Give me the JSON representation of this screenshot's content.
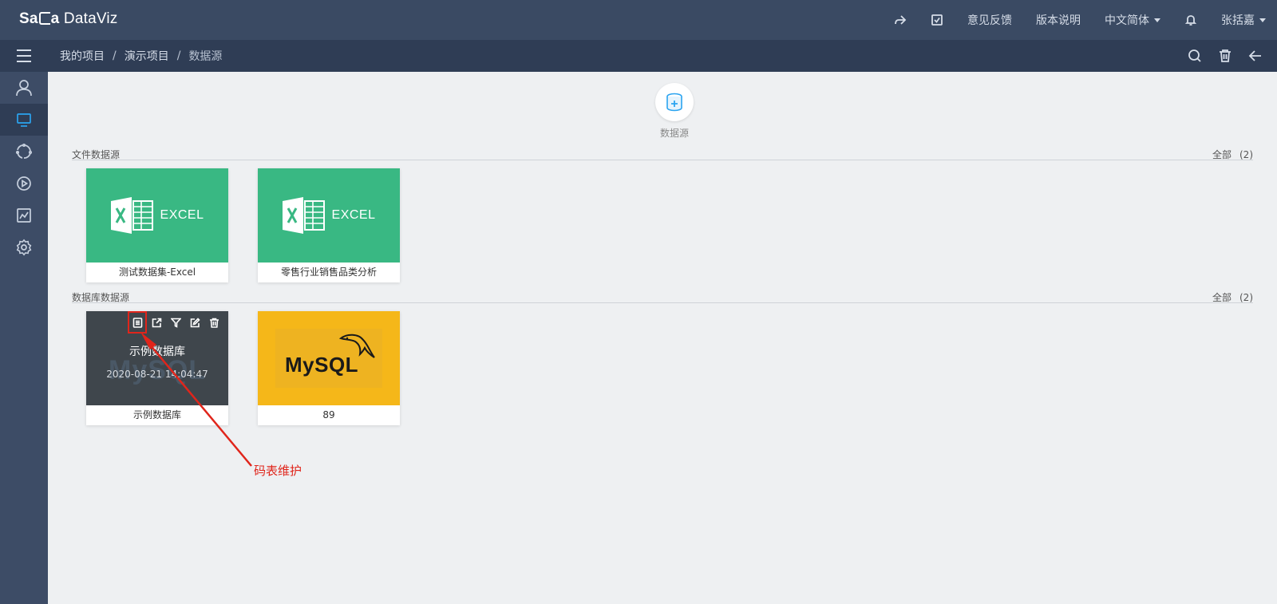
{
  "app": {
    "logo_left": "Sa",
    "logo_mid": "C",
    "logo_a": "a",
    "logo_right": " DataViz"
  },
  "header": {
    "share_icon": "share-icon",
    "task_icon": "checkbox-icon",
    "feedback": "意见反馈",
    "release_notes": "版本说明",
    "language": "中文简体",
    "bell_icon": "bell-icon",
    "user": "张括嘉"
  },
  "breadcrumb": {
    "items": [
      "我的项目",
      "演示项目",
      "数据源"
    ],
    "separator": "/"
  },
  "toolbar": {
    "icons": [
      "search-icon",
      "trash-icon",
      "back-arrow-icon"
    ]
  },
  "sidebar": {
    "items": [
      "user-icon",
      "monitor-icon",
      "cycle-icon",
      "play-icon",
      "chart-icon",
      "settings-icon"
    ],
    "active_index": 1
  },
  "add_datasource": {
    "label": "数据源"
  },
  "file_section": {
    "title": "文件数据源",
    "all_label": "全部",
    "count": "(2)",
    "cards": [
      {
        "type": "excel",
        "logo_text": "EXCEL",
        "name": "测试数据集-Excel"
      },
      {
        "type": "excel",
        "logo_text": "EXCEL",
        "name": "零售行业销售品类分析"
      }
    ]
  },
  "db_section": {
    "title": "数据库数据源",
    "all_label": "全部",
    "count": "(2)",
    "cards": [
      {
        "type": "mysql-hover",
        "overlay_title": "示例数据库",
        "overlay_date": "2020-08-21 14:04:47",
        "watermark": "MySQL",
        "name": "示例数据库",
        "actions": [
          "code-table-icon",
          "export-icon",
          "filter-icon",
          "edit-icon",
          "delete-icon"
        ]
      },
      {
        "type": "mysql",
        "logo_text": "MySQL",
        "name": "89"
      }
    ]
  },
  "annotation": {
    "label": "码表维护",
    "color": "#e0251b"
  },
  "colors": {
    "topbar": "#3a4a63",
    "subbar": "#2f3d55",
    "sidebar": "#3d4c66",
    "excel_green": "#39b883",
    "mysql_yellow": "#f5b719",
    "active_blue": "#2ba4f0"
  }
}
